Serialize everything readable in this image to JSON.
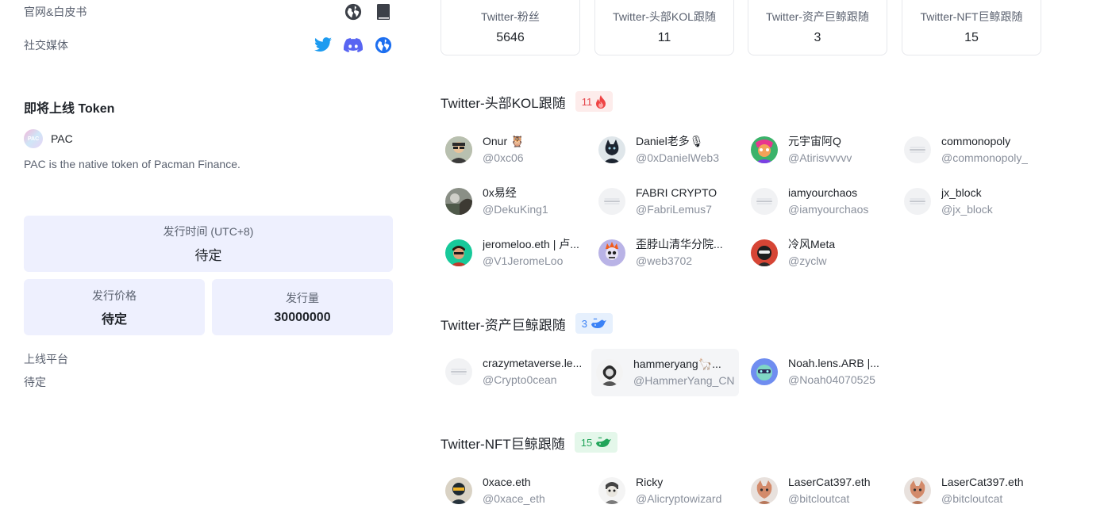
{
  "left": {
    "website_label": "官网&白皮书",
    "social_label": "社交媒体",
    "upcoming_title": "即将上线 Token",
    "token": {
      "symbol": "PAC",
      "description": "PAC is the native token of Pacman Finance."
    },
    "issue_time": {
      "label": "发行时间 (UTC+8)",
      "value": "待定"
    },
    "issue_price": {
      "label": "发行价格",
      "value": "待定"
    },
    "issue_amount": {
      "label": "发行量",
      "value": "30000000"
    },
    "platform_label": "上线平台",
    "platform_value": "待定"
  },
  "stats": [
    {
      "label": "Twitter-粉丝",
      "value": "5646"
    },
    {
      "label": "Twitter-头部KOL跟随",
      "value": "11"
    },
    {
      "label": "Twitter-资产巨鲸跟随",
      "value": "3"
    },
    {
      "label": "Twitter-NFT巨鲸跟随",
      "value": "15"
    }
  ],
  "kol": {
    "title": "Twitter-头部KOL跟随",
    "count": "11",
    "people": [
      {
        "name": "Onur 🦉",
        "handle": "@0xc06"
      },
      {
        "name": "Daniel老多🎙",
        "handle": "@0xDanielWeb3"
      },
      {
        "name": "元宇宙阿Q",
        "handle": "@Atirisvvvvv"
      },
      {
        "name": "commonopoly",
        "handle": "@commonopoly_"
      },
      {
        "name": "0x易经",
        "handle": "@DekuKing1"
      },
      {
        "name": "FABRI CRYPTO",
        "handle": "@FabriLemus7"
      },
      {
        "name": "iamyourchaos",
        "handle": "@iamyourchaos"
      },
      {
        "name": "jx_block",
        "handle": "@jx_block"
      },
      {
        "name": "jeromeloo.eth | 卢...",
        "handle": "@V1JeromeLoo"
      },
      {
        "name": "歪脖山清华分院...",
        "handle": "@web3702"
      },
      {
        "name": "冷风Meta",
        "handle": "@zyclw"
      }
    ]
  },
  "whale": {
    "title": "Twitter-资产巨鲸跟随",
    "count": "3",
    "people": [
      {
        "name": "crazymetaverse.le...",
        "handle": "@Crypto0cean"
      },
      {
        "name": "hammeryang🦙...",
        "handle": "@HammerYang_CN"
      },
      {
        "name": "Noah.lens.ARB |...",
        "handle": "@Noah04070525"
      }
    ]
  },
  "nft": {
    "title": "Twitter-NFT巨鲸跟随",
    "count": "15",
    "people": [
      {
        "name": "0xace.eth",
        "handle": "@0xace_eth"
      },
      {
        "name": "Ricky",
        "handle": "@Alicryptowizard"
      },
      {
        "name": "LaserCat397.eth",
        "handle": "@bitcloutcat"
      },
      {
        "name": "LaserCat397.eth",
        "handle": "@bitcloutcat"
      }
    ]
  },
  "colors": {
    "twitter": "#1d9bf0",
    "discord": "#5865f2",
    "box_bg": "#eef0fe"
  }
}
